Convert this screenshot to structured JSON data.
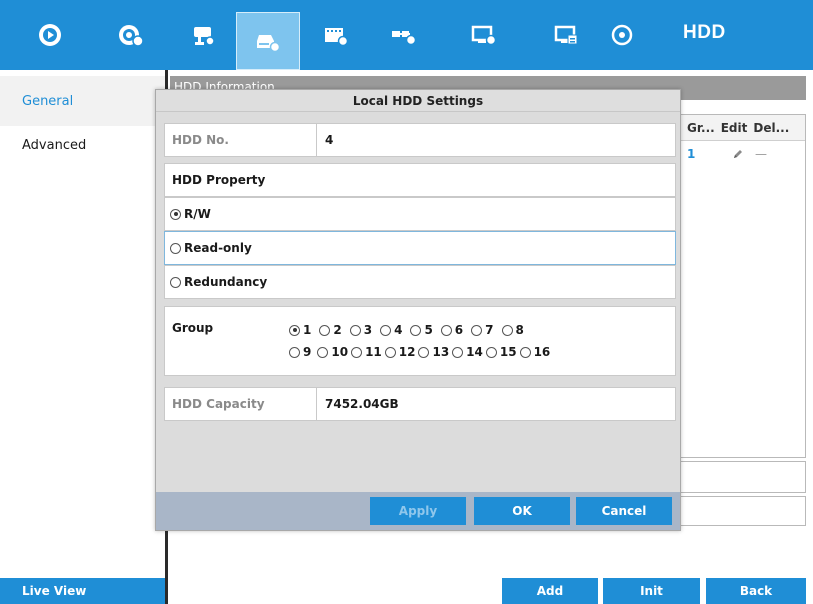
{
  "toolbar": {
    "items": [
      {
        "icon": "play-circle-icon"
      },
      {
        "icon": "camera-settings-icon"
      },
      {
        "icon": "camera-record-icon"
      },
      {
        "icon": "hdd-settings-icon",
        "active": true
      },
      {
        "icon": "video-config-icon"
      },
      {
        "icon": "network-settings-icon"
      },
      {
        "icon": "display-settings-icon"
      },
      {
        "icon": "system-info-icon"
      },
      {
        "icon": "power-icon"
      }
    ],
    "title": "HDD"
  },
  "sidebar": {
    "items": [
      {
        "label": "General",
        "selected": true
      },
      {
        "label": "Advanced",
        "selected": false
      }
    ],
    "live_view": "Live View"
  },
  "background": {
    "header": "HDD Information",
    "table": {
      "columns": [
        "Gr...",
        "Edit",
        "Del..."
      ],
      "row": {
        "group": "1",
        "delete": "—"
      }
    },
    "buttons": {
      "add": "Add",
      "init": "Init",
      "back": "Back"
    }
  },
  "dialog": {
    "title": "Local HDD Settings",
    "hdd_no_label": "HDD No.",
    "hdd_no_value": "4",
    "property_label": "HDD Property",
    "property_options": [
      {
        "label": "R/W",
        "checked": true
      },
      {
        "label": "Read-only",
        "checked": false
      },
      {
        "label": "Redundancy",
        "checked": false
      }
    ],
    "group_label": "Group",
    "group_options": [
      {
        "label": "1",
        "checked": true
      },
      {
        "label": "2",
        "checked": false
      },
      {
        "label": "3",
        "checked": false
      },
      {
        "label": "4",
        "checked": false
      },
      {
        "label": "5",
        "checked": false
      },
      {
        "label": "6",
        "checked": false
      },
      {
        "label": "7",
        "checked": false
      },
      {
        "label": "8",
        "checked": false
      },
      {
        "label": "9",
        "checked": false
      },
      {
        "label": "10",
        "checked": false
      },
      {
        "label": "11",
        "checked": false
      },
      {
        "label": "12",
        "checked": false
      },
      {
        "label": "13",
        "checked": false
      },
      {
        "label": "14",
        "checked": false
      },
      {
        "label": "15",
        "checked": false
      },
      {
        "label": "16",
        "checked": false
      }
    ],
    "capacity_label": "HDD Capacity",
    "capacity_value": "7452.04GB",
    "buttons": {
      "apply": "Apply",
      "ok": "OK",
      "cancel": "Cancel"
    }
  },
  "colors": {
    "accent": "#1f8ed6",
    "active_tab": "#7ec4ee",
    "footer": "#a9b6c8"
  }
}
